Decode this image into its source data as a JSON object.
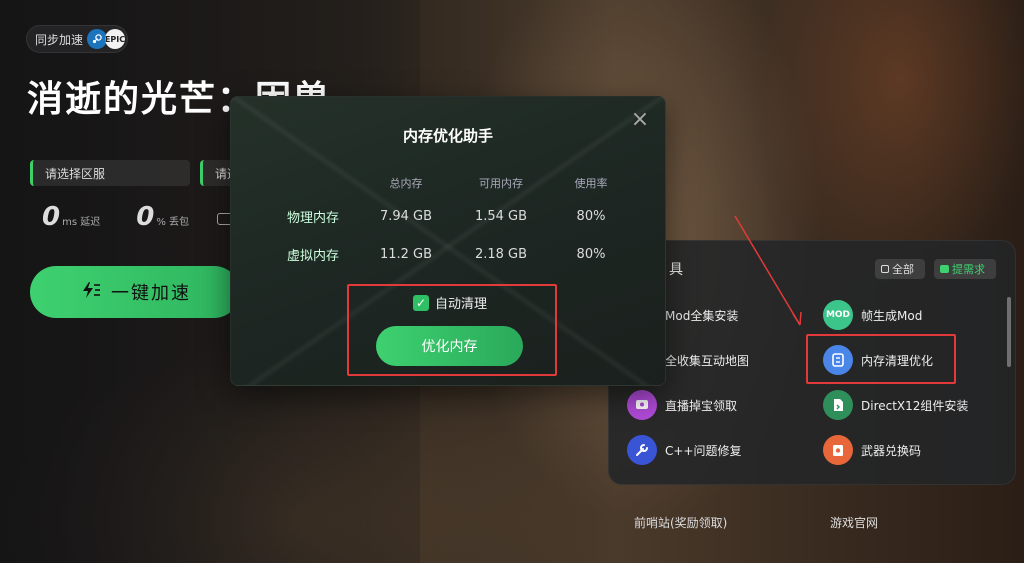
{
  "top_badge": {
    "label": "同步加速",
    "platforms": [
      "steam-icon",
      "epic-icon"
    ],
    "epic_text": "EPIC"
  },
  "game": {
    "title": "消逝的光芒：困兽"
  },
  "region": {
    "select_label": "请选择区服",
    "second_label": "请选"
  },
  "stats": [
    {
      "value": "0",
      "unit": "ms 延迟"
    },
    {
      "value": "0",
      "unit": "% 丢包"
    }
  ],
  "accelerate_button": {
    "label": "一键加速",
    "icon": "bolt-icon"
  },
  "memory_dialog": {
    "title": "内存优化助手",
    "columns": [
      "",
      "总内存",
      "可用内存",
      "使用率"
    ],
    "rows": [
      {
        "name": "物理内存",
        "total": "7.94 GB",
        "available": "1.54 GB",
        "usage": "80%"
      },
      {
        "name": "虚拟内存",
        "total": "11.2 GB",
        "available": "2.18 GB",
        "usage": "80%"
      }
    ],
    "auto_clean_label": "自动清理",
    "auto_clean_checked": true,
    "optimize_button": "优化内存"
  },
  "tools_panel": {
    "title": "具",
    "filter_all": "全部",
    "filter_request": "提需求",
    "items": [
      {
        "label": "Mod全集安装",
        "icon": "mod-icon"
      },
      {
        "label": "帧生成Mod",
        "icon": "mod-frame-icon",
        "icon_text": "MOD"
      },
      {
        "label": "全收集互动地图",
        "icon": "map-icon"
      },
      {
        "label": "内存清理优化",
        "icon": "memory-clean-icon"
      },
      {
        "label": "直播掉宝领取",
        "icon": "live-drop-icon"
      },
      {
        "label": "DirectX12组件安装",
        "icon": "directx-icon"
      },
      {
        "label": "C++问题修复",
        "icon": "cpp-fix-icon"
      },
      {
        "label": "武器兑换码",
        "icon": "weapon-code-icon"
      }
    ]
  },
  "footer": {
    "outpost_link": "前哨站(奖励领取)",
    "official_link": "游戏官网"
  },
  "colors": {
    "accent_green": "#3ed170",
    "highlight_red": "#e23a3a"
  }
}
